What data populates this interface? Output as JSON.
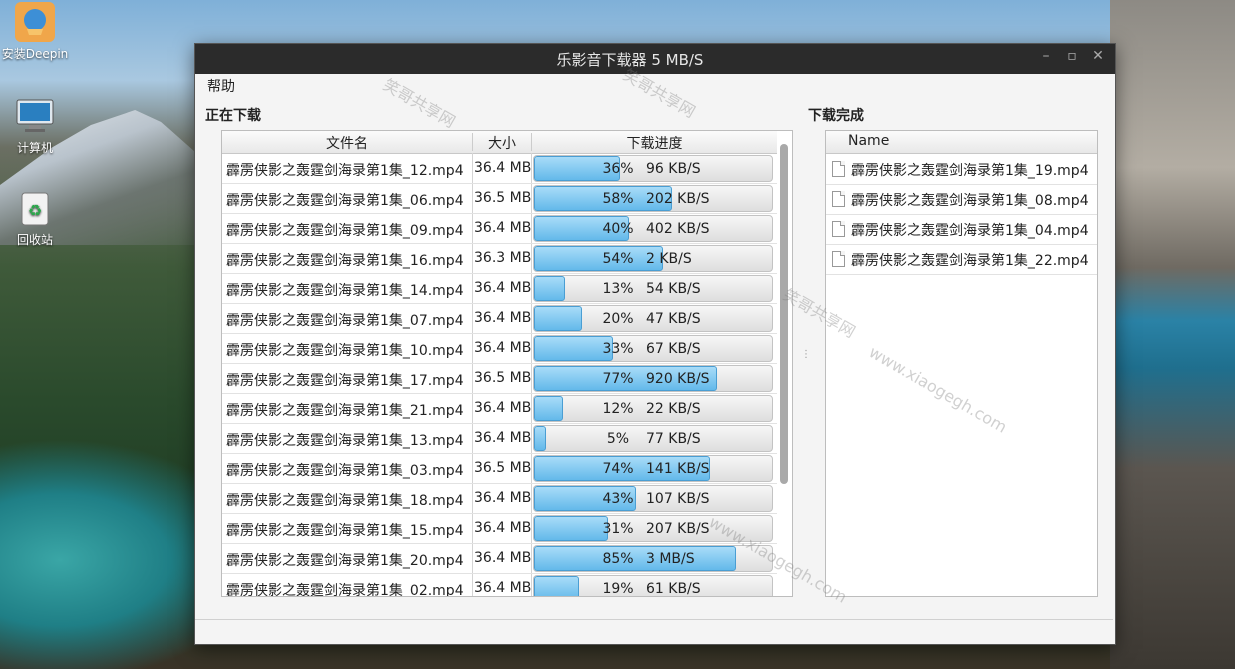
{
  "desktop": {
    "icons": [
      {
        "label": "安装Deepin",
        "icon": "deepin-installer-icon"
      },
      {
        "label": "计算机",
        "icon": "computer-icon"
      },
      {
        "label": "回收站",
        "icon": "trash-icon"
      }
    ]
  },
  "window": {
    "title": "乐影音下载器   5 MB/S",
    "controls": {
      "minimize": "–",
      "maximize": "▫",
      "close": "✕"
    }
  },
  "menu": {
    "help": "帮助"
  },
  "downloading": {
    "label": "正在下载",
    "columns": {
      "name": "文件名",
      "size": "大小",
      "progress": "下载进度"
    },
    "rows": [
      {
        "name": "霹雳侠影之轰霆剑海录第1集_12.mp4",
        "size": "36.4 MB",
        "percent": 36,
        "percent_text": "36%",
        "speed": "96 KB/S"
      },
      {
        "name": "霹雳侠影之轰霆剑海录第1集_06.mp4",
        "size": "36.5 MB",
        "percent": 58,
        "percent_text": "58%",
        "speed": "202 KB/S"
      },
      {
        "name": "霹雳侠影之轰霆剑海录第1集_09.mp4",
        "size": "36.4 MB",
        "percent": 40,
        "percent_text": "40%",
        "speed": "402 KB/S"
      },
      {
        "name": "霹雳侠影之轰霆剑海录第1集_16.mp4",
        "size": "36.3 MB",
        "percent": 54,
        "percent_text": "54%",
        "speed": "2 KB/S"
      },
      {
        "name": "霹雳侠影之轰霆剑海录第1集_14.mp4",
        "size": "36.4 MB",
        "percent": 13,
        "percent_text": "13%",
        "speed": "54 KB/S"
      },
      {
        "name": "霹雳侠影之轰霆剑海录第1集_07.mp4",
        "size": "36.4 MB",
        "percent": 20,
        "percent_text": "20%",
        "speed": "47 KB/S"
      },
      {
        "name": "霹雳侠影之轰霆剑海录第1集_10.mp4",
        "size": "36.4 MB",
        "percent": 33,
        "percent_text": "33%",
        "speed": "67 KB/S"
      },
      {
        "name": "霹雳侠影之轰霆剑海录第1集_17.mp4",
        "size": "36.5 MB",
        "percent": 77,
        "percent_text": "77%",
        "speed": "920 KB/S"
      },
      {
        "name": "霹雳侠影之轰霆剑海录第1集_21.mp4",
        "size": "36.4 MB",
        "percent": 12,
        "percent_text": "12%",
        "speed": "22 KB/S"
      },
      {
        "name": "霹雳侠影之轰霆剑海录第1集_13.mp4",
        "size": "36.4 MB",
        "percent": 5,
        "percent_text": "5%",
        "speed": "77 KB/S"
      },
      {
        "name": "霹雳侠影之轰霆剑海录第1集_03.mp4",
        "size": "36.5 MB",
        "percent": 74,
        "percent_text": "74%",
        "speed": "141 KB/S"
      },
      {
        "name": "霹雳侠影之轰霆剑海录第1集_18.mp4",
        "size": "36.4 MB",
        "percent": 43,
        "percent_text": "43%",
        "speed": "107 KB/S"
      },
      {
        "name": "霹雳侠影之轰霆剑海录第1集_15.mp4",
        "size": "36.4 MB",
        "percent": 31,
        "percent_text": "31%",
        "speed": "207 KB/S"
      },
      {
        "name": "霹雳侠影之轰霆剑海录第1集_20.mp4",
        "size": "36.4 MB",
        "percent": 85,
        "percent_text": "85%",
        "speed": "3 MB/S"
      },
      {
        "name": "霹雳侠影之轰霆剑海录第1集_02.mp4",
        "size": "36.4 MB",
        "percent": 19,
        "percent_text": "19%",
        "speed": "61 KB/S"
      }
    ]
  },
  "completed": {
    "label": "下载完成",
    "column": "Name",
    "items": [
      "霹雳侠影之轰霆剑海录第1集_19.mp4",
      "霹雳侠影之轰霆剑海录第1集_08.mp4",
      "霹雳侠影之轰霆剑海录第1集_04.mp4",
      "霹雳侠影之轰霆剑海录第1集_22.mp4"
    ]
  },
  "watermark": {
    "text1": "笑哥共享网",
    "text2": "www.xiaogegh.com"
  },
  "colors": {
    "progress_fill": "#63b9ea",
    "titlebar": "#2b2b2b"
  }
}
